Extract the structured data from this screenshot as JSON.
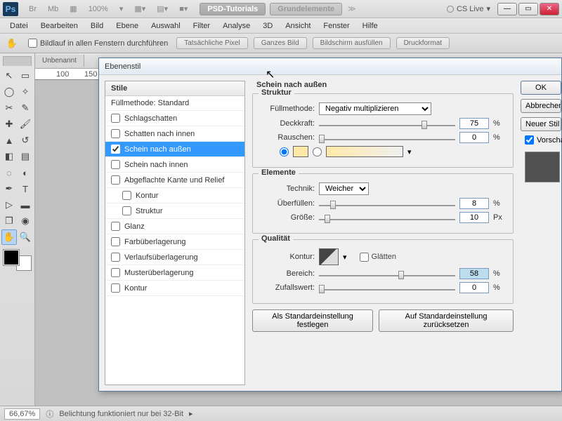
{
  "title_tools": [
    "Br",
    "Mb",
    "▦",
    "100%",
    "▾",
    "▦▾",
    "▤▾",
    "■▾"
  ],
  "tabs": [
    {
      "label": "PSD-Tutorials",
      "active": true
    },
    {
      "label": "Grundelemente",
      "active": false
    }
  ],
  "cslive": "CS Live",
  "menu": [
    "Datei",
    "Bearbeiten",
    "Bild",
    "Ebene",
    "Auswahl",
    "Filter",
    "Analyse",
    "3D",
    "Ansicht",
    "Fenster",
    "Hilfe"
  ],
  "optbar": {
    "scroll_all": "Bildlauf in allen Fenstern durchführen",
    "pills": [
      "Tatsächliche Pixel",
      "Ganzes Bild",
      "Bildschirm ausfüllen",
      "Druckformat"
    ]
  },
  "doc_tab": "Unbenannt",
  "ruler_marks": [
    "100",
    "150"
  ],
  "status": {
    "zoom": "66,67%",
    "msg": "Belichtung funktioniert nur bei 32-Bit"
  },
  "dialog": {
    "title": "Ebenenstil",
    "styles_header": "Stile",
    "styles": [
      {
        "label": "Füllmethode: Standard",
        "chk": null
      },
      {
        "label": "Schlagschatten",
        "chk": false
      },
      {
        "label": "Schatten nach innen",
        "chk": false
      },
      {
        "label": "Schein nach außen",
        "chk": true,
        "sel": true
      },
      {
        "label": "Schein nach innen",
        "chk": false
      },
      {
        "label": "Abgeflachte Kante und Relief",
        "chk": false
      },
      {
        "label": "Kontur",
        "chk": false,
        "sub": true
      },
      {
        "label": "Struktur",
        "chk": false,
        "sub": true
      },
      {
        "label": "Glanz",
        "chk": false
      },
      {
        "label": "Farbüberlagerung",
        "chk": false
      },
      {
        "label": "Verlaufsüberlagerung",
        "chk": false
      },
      {
        "label": "Musterüberlagerung",
        "chk": false
      },
      {
        "label": "Kontur",
        "chk": false
      }
    ],
    "section_title": "Schein nach außen",
    "struktur": {
      "title": "Struktur",
      "fuellmethode_lbl": "Füllmethode",
      "fuellmethode": "Negativ multiplizieren",
      "deckkraft_lbl": "Deckkraft",
      "deckkraft": "75",
      "deckkraft_u": "%",
      "rauschen_lbl": "Rauschen",
      "rauschen": "0",
      "rauschen_u": "%"
    },
    "elemente": {
      "title": "Elemente",
      "technik_lbl": "Technik",
      "technik": "Weicher",
      "ueberfuellen_lbl": "Überfüllen",
      "ueberfuellen": "8",
      "ueberfuellen_u": "%",
      "groesse_lbl": "Größe",
      "groesse": "10",
      "groesse_u": "Px"
    },
    "qualitaet": {
      "title": "Qualität",
      "kontur_lbl": "Kontur",
      "glaetten": "Glätten",
      "bereich_lbl": "Bereich",
      "bereich": "58",
      "bereich_u": "%",
      "zufall_lbl": "Zufallswert",
      "zufall": "0",
      "zufall_u": "%"
    },
    "set_default": "Als Standardeinstellung festlegen",
    "reset_default": "Auf Standardeinstellung zurücksetzen",
    "ok": "OK",
    "cancel": "Abbrechen",
    "new_style": "Neuer Stil",
    "preview": "Vorschau"
  }
}
